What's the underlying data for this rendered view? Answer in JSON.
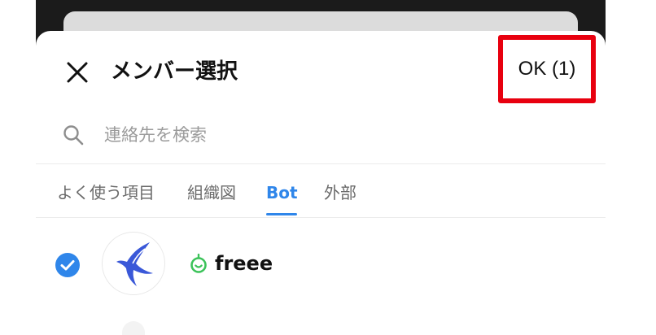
{
  "header": {
    "title": "メンバー選択",
    "ok_label": "OK (1)"
  },
  "search": {
    "placeholder": "連絡先を検索"
  },
  "tabs": [
    {
      "label": "よく使う項目",
      "active": false
    },
    {
      "label": "組織図",
      "active": false
    },
    {
      "label": "Bot",
      "active": true
    },
    {
      "label": "外部",
      "active": false
    }
  ],
  "members": [
    {
      "name": "freee",
      "selected": true,
      "type": "bot"
    }
  ],
  "colors": {
    "accent": "#2f86ea",
    "highlight_box": "#e8000f",
    "bot_icon": "#3cc35a",
    "avatar_logo": "#3a58d8"
  },
  "icons": {
    "close": "close-icon",
    "search": "search-icon",
    "check": "check-circle-icon",
    "bot": "bot-icon",
    "avatar": "swallow-logo-icon"
  }
}
